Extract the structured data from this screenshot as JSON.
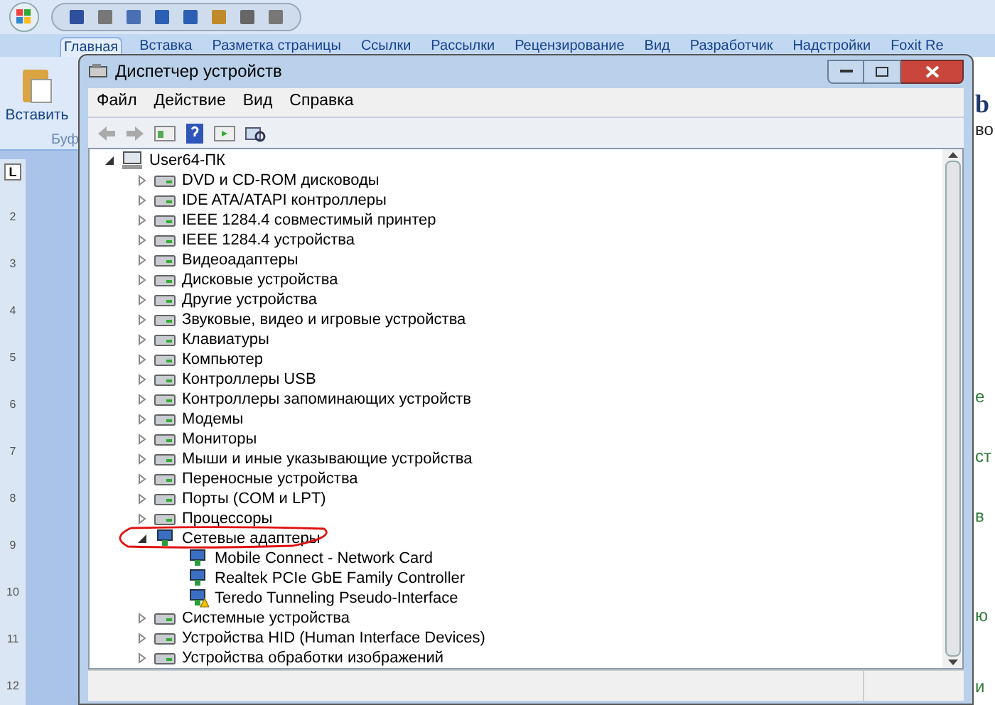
{
  "word": {
    "tabs": [
      {
        "label": "Главная",
        "selected": true
      },
      {
        "label": "Вставка",
        "selected": false
      },
      {
        "label": "Разметка страницы",
        "selected": false
      },
      {
        "label": "Ссылки",
        "selected": false
      },
      {
        "label": "Рассылки",
        "selected": false
      },
      {
        "label": "Рецензирование",
        "selected": false
      },
      {
        "label": "Вид",
        "selected": false
      },
      {
        "label": "Разработчик",
        "selected": false
      },
      {
        "label": "Надстройки",
        "selected": false
      },
      {
        "label": "Foxit Re",
        "selected": false
      }
    ],
    "paste_label": "Вставить",
    "group_label": "Буф",
    "ruler_corner": "L",
    "ruler_numbers": [
      "2",
      "3",
      "4",
      "5",
      "6",
      "7",
      "8",
      "9",
      "10",
      "11",
      "12"
    ],
    "document_fragments": [
      {
        "text": "b",
        "kind": "heading"
      },
      {
        "text": "во",
        "kind": "body"
      },
      {
        "text": "е",
        "kind": "link"
      },
      {
        "text": "ст",
        "kind": "link"
      },
      {
        "text": "в",
        "kind": "link"
      },
      {
        "text": "ю",
        "kind": "link"
      },
      {
        "text": "и",
        "kind": "link"
      }
    ]
  },
  "window": {
    "title": "Диспетчер устройств",
    "menu": [
      "Файл",
      "Действие",
      "Вид",
      "Справка"
    ],
    "tree": {
      "label": "User64-ПК",
      "kind": "computer",
      "expanded": true,
      "children": [
        {
          "label": "DVD и CD-ROM дисководы",
          "kind": "category",
          "expanded": false
        },
        {
          "label": "IDE ATA/ATAPI контроллеры",
          "kind": "category",
          "expanded": false
        },
        {
          "label": "IEEE 1284.4 совместимый принтер",
          "kind": "category",
          "expanded": false
        },
        {
          "label": "IEEE 1284.4 устройства",
          "kind": "category",
          "expanded": false
        },
        {
          "label": "Видеоадаптеры",
          "kind": "category",
          "expanded": false
        },
        {
          "label": "Дисковые устройства",
          "kind": "category",
          "expanded": false
        },
        {
          "label": "Другие устройства",
          "kind": "category",
          "expanded": false
        },
        {
          "label": "Звуковые, видео и игровые устройства",
          "kind": "category",
          "expanded": false
        },
        {
          "label": "Клавиатуры",
          "kind": "category",
          "expanded": false
        },
        {
          "label": "Компьютер",
          "kind": "category",
          "expanded": false
        },
        {
          "label": "Контроллеры USB",
          "kind": "category",
          "expanded": false
        },
        {
          "label": "Контроллеры запоминающих устройств",
          "kind": "category",
          "expanded": false
        },
        {
          "label": "Модемы",
          "kind": "category",
          "expanded": false
        },
        {
          "label": "Мониторы",
          "kind": "category",
          "expanded": false
        },
        {
          "label": "Мыши и иные указывающие устройства",
          "kind": "category",
          "expanded": false
        },
        {
          "label": "Переносные устройства",
          "kind": "category",
          "expanded": false
        },
        {
          "label": "Порты (COM и LPT)",
          "kind": "category",
          "expanded": false
        },
        {
          "label": "Процессоры",
          "kind": "category",
          "expanded": false
        },
        {
          "label": "Сетевые адаптеры",
          "kind": "network",
          "expanded": true,
          "children": [
            {
              "label": "Mobile Connect - Network Card",
              "kind": "network",
              "warning": false
            },
            {
              "label": "Realtek PCIe GbE Family Controller",
              "kind": "network",
              "warning": false
            },
            {
              "label": "Teredo Tunneling Pseudo-Interface",
              "kind": "network",
              "warning": true
            }
          ]
        },
        {
          "label": "Системные устройства",
          "kind": "category",
          "expanded": false
        },
        {
          "label": "Устройства HID (Human Interface Devices)",
          "kind": "category",
          "expanded": false
        },
        {
          "label": "Устройства обработки изображений",
          "kind": "category",
          "expanded": false
        }
      ]
    }
  }
}
